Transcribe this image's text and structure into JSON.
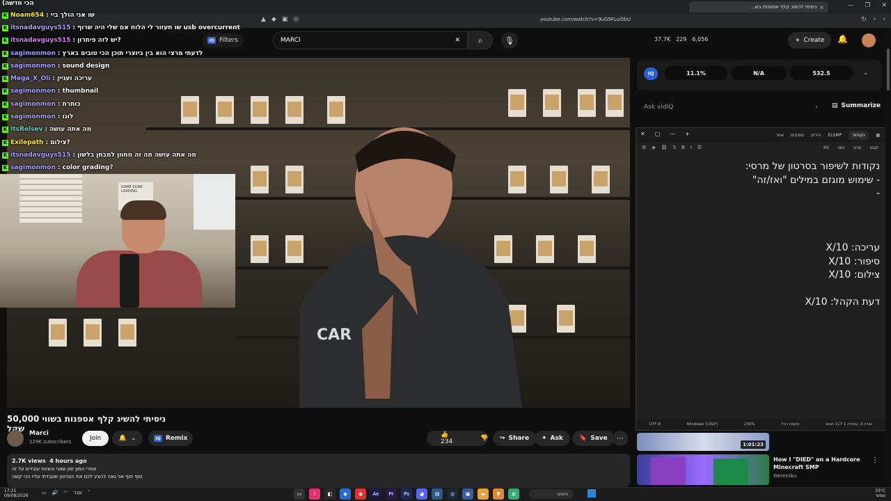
{
  "browser": {
    "tab_title": "ניסיתי להשיג קלף אספנות בש...",
    "tab_close": "×",
    "url": "youtube.com/watch?v=9uG9FLui5bU",
    "window_controls": [
      "—",
      "❐",
      "✕"
    ]
  },
  "header": {
    "filters_label": "Filters",
    "search_value": "MARCI",
    "stats": [
      "37.7K",
      "229",
      "6,056"
    ],
    "create_label": "Create"
  },
  "chat": {
    "header": "(הכי חדשה",
    "lines": [
      {
        "user": "Noam654",
        "msg": ": שו אני הולך ביי",
        "cls": "green"
      },
      {
        "user": "itsnadavguys515",
        "msg": ": שו תעזור לי הלוח אם שלי היה שרוף usb overcurrent",
        "cls": ""
      },
      {
        "user": "itsnadavguys515",
        "msg": ": יש לזה פיתרון?",
        "cls": "pink"
      },
      {
        "user": "sagimonmon",
        "msg": ": לדעתי מרצי הוא בין ביוצרי תוכן הכי טובים בארץ",
        "cls": ""
      },
      {
        "user": "sagimonmon",
        "msg": ": sound design",
        "cls": ""
      },
      {
        "user": "Mega_X_Oli",
        "msg": ": עריכה ועניין",
        "cls": ""
      },
      {
        "user": "sagimonmon",
        "msg": ": thumbnail",
        "cls": ""
      },
      {
        "user": "sagimonmon",
        "msg": ": כותרת",
        "cls": ""
      },
      {
        "user": "sagimonmon",
        "msg": ": לוגו",
        "cls": ""
      },
      {
        "user": "ItsRelsev",
        "msg": ": מה אתה עושה",
        "cls": "teal"
      },
      {
        "user": "Exilepath",
        "msg": ": צילום?",
        "cls": "green"
      },
      {
        "user": "itsnadavguys515",
        "msg": ": מה אתה עושה מה זה מחוון למבחן בלשון",
        "cls": ""
      },
      {
        "user": "sagimonmon",
        "msg": ": color grading?",
        "cls": ""
      }
    ]
  },
  "webcam": {
    "poster_text": "GAME ZONE LOADING"
  },
  "video": {
    "title": "ניסיתי להשיג קלף אספנות בשווי 50,000 שקל",
    "channel": "Marci",
    "subscribers": "129K subscribers",
    "join_label": "Join",
    "remix_label": "Remix",
    "likes": "234",
    "share_label": "Share",
    "ask_label": "Ask",
    "save_label": "Save",
    "more": "⋯",
    "views": "2.7K views",
    "age": "4 hours ago",
    "desc_line1": "אחרי המון זמן שאני והצוות עובדים על זה",
    "desc_line2": "סוף סוף אני גאה להציג לכם את הסרטון שעבדתי עליו הכי קשה"
  },
  "vidiq": {
    "logo": "IQ",
    "stats": [
      "11.1%",
      "N/A",
      "532.5"
    ],
    "ask_placeholder": "Ask vidIQ",
    "summarize_label": "Summarize"
  },
  "notepad": {
    "tabs": [
      "קובץ",
      "נקודות",
      "ELSMP",
      "הירוק",
      "סופקים",
      "אחר"
    ],
    "active_tab": "נקודות",
    "menu": [
      "קובץ",
      "ערוך",
      "הצג"
    ],
    "heading_btn": "H1",
    "lines": [
      "נקודות לשיפור בסרטון של מרסי:",
      "- שימוש מוגזם במילים \"ואז/זה\"",
      "-",
      "",
      "",
      "",
      "עריכה: X/10",
      "סיפור: X/10",
      "צילום: X/10",
      "",
      "דעת הקהל: X/10"
    ],
    "status": [
      "שורה 3, עמודה 1 117 תווים",
      "טקסט רגיל",
      "230%",
      "Windows (CRLF)",
      "UTF-8"
    ]
  },
  "related": {
    "duration": "1:01:23",
    "title": "How I \"DIED\" on a Hardcore Minecraft SMP",
    "channel": "Wemmbu"
  },
  "taskbar": {
    "time_left": "17:21",
    "date_left": "09/08/2026",
    "lang": "עבר",
    "search_placeholder": "חיפוש",
    "temp": "33°C",
    "weather": "שמשי"
  },
  "colors": {
    "kick_green": "#53fc18",
    "yt_bg": "#0f0f0f",
    "vidiq_blue": "#2e5fd0"
  }
}
